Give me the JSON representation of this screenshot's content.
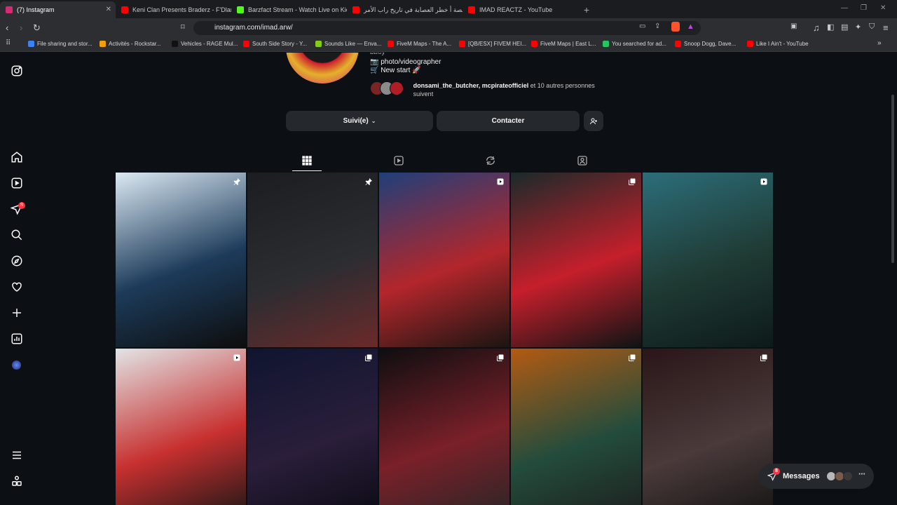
{
  "browser": {
    "tabs": [
      {
        "title": "(7) Instagram",
        "active": true,
        "favicon": "instagram-icon",
        "color": "#d62976"
      },
      {
        "title": "Keni Clan Presents Braderz - F'Dlam",
        "favicon": "youtube-icon",
        "color": "#ff0000"
      },
      {
        "title": "Barzfact Stream - Watch Live on Kick",
        "favicon": "kick-icon",
        "color": "#53fc18"
      },
      {
        "title": "قصة أ خطر العصابة في تاريخ راب الأمر",
        "favicon": "youtube-icon",
        "color": "#ff0000"
      },
      {
        "title": "IMAD REACTZ - YouTube",
        "favicon": "youtube-icon",
        "color": "#ff0000"
      }
    ],
    "new_tab": "+",
    "url": "instagram.com/imad.arw/",
    "bookmarks": [
      {
        "label": "File sharing and stor...",
        "color": "#3b82f6"
      },
      {
        "label": "Activités - Rockstar...",
        "color": "#f59e0b"
      },
      {
        "label": "Vehicles - RAGE Mul...",
        "color": "#111111"
      },
      {
        "label": "South Side Story - Y...",
        "color": "#ff0000"
      },
      {
        "label": "Sounds Like — Enva...",
        "color": "#84cc16"
      },
      {
        "label": "FiveM Maps - The A...",
        "color": "#ff0000"
      },
      {
        "label": "[QB/ESX] FIVEM HEI...",
        "color": "#ff0000"
      },
      {
        "label": "FiveM Maps | East L...",
        "color": "#ff0000"
      },
      {
        "label": "You searched for ad...",
        "color": "#22c55e"
      },
      {
        "label": "Snoop Dogg, Dave...",
        "color": "#ff0000"
      },
      {
        "label": "Like I Ain't - YouTube",
        "color": "#ff0000"
      }
    ]
  },
  "profile": {
    "bio": [
      "bboy",
      "📷 photo/videographer",
      "🛒 New start 🚀"
    ],
    "followed_by_names": "donsami_the_butcher, mcpirateofficiel",
    "followed_by_rest": " et 10 autres personnes suivent",
    "following_button": "Suivi(e)",
    "contact_button": "Contacter"
  },
  "sidebar": {
    "notifications_badge": "8"
  },
  "messages": {
    "label": "Messages",
    "badge": "8"
  },
  "grid": [
    {
      "mark": "pin-icon",
      "colors": [
        "#dbe9f3",
        "#1c3b5a",
        "#0d0d0d"
      ]
    },
    {
      "mark": "pin-icon",
      "colors": [
        "#1b1d21",
        "#2b2d31",
        "#6b2a2a"
      ]
    },
    {
      "mark": "reel-icon",
      "colors": [
        "#1f3f7a",
        "#b3262b",
        "#1a1512"
      ]
    },
    {
      "mark": "carousel-icon",
      "colors": [
        "#1a2a2a",
        "#c51f2b",
        "#0e1414"
      ]
    },
    {
      "mark": "reel-icon",
      "colors": [
        "#2c6e7a",
        "#1f3a33",
        "#0d1a1a"
      ]
    },
    {
      "mark": "reel-icon",
      "colors": [
        "#e2e4e6",
        "#c7302f",
        "#151515"
      ]
    },
    {
      "mark": "carousel-icon",
      "colors": [
        "#0f1530",
        "#2a1e3a",
        "#0a0a12"
      ]
    },
    {
      "mark": "carousel-icon",
      "colors": [
        "#0e0e10",
        "#7a2029",
        "#262626"
      ]
    },
    {
      "mark": "carousel-icon",
      "colors": [
        "#b35a12",
        "#234c3c",
        "#1d1d1d"
      ]
    },
    {
      "mark": "carousel-icon",
      "colors": [
        "#2a1618",
        "#4a3a3a",
        "#121212"
      ]
    }
  ]
}
